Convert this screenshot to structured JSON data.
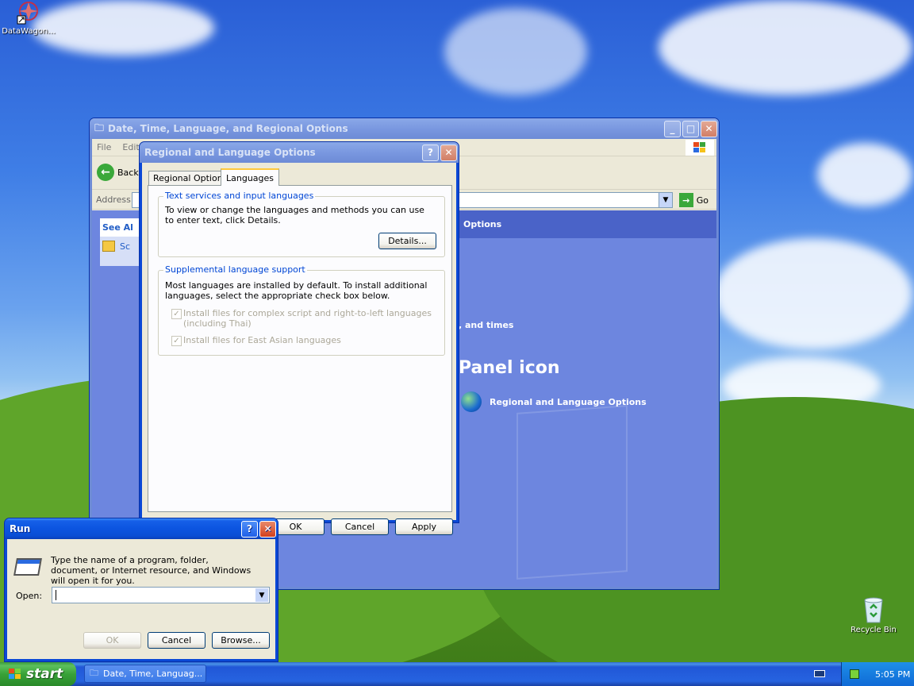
{
  "desktop": {
    "icons": [
      {
        "label": "DataWagon..."
      },
      {
        "label": "Recycle Bin"
      }
    ]
  },
  "control_panel_window": {
    "title": "Date, Time, Language, and Regional Options",
    "menu": [
      "File",
      "Edit"
    ],
    "back_label": "Back",
    "address_label": "Address",
    "go_label": "Go",
    "see_also": "See Al",
    "side_item": "Sc",
    "header_fragment": "Options",
    "task_fragment": ", and times",
    "pick_heading": "Panel icon",
    "cp_icon_label": "Regional and Language Options"
  },
  "regional_dialog": {
    "title": "Regional and Language Options",
    "help_glyph": "?",
    "close_glyph": "✕",
    "tabs": [
      "Regional Options",
      "Languages"
    ],
    "active_tab": "Languages",
    "text_services": {
      "legend": "Text services and input languages",
      "desc": "To view or change the languages and methods you can use to enter text, click Details.",
      "details_button": "Details..."
    },
    "supplemental": {
      "legend": "Supplemental language support",
      "desc": "Most languages are installed by default. To install additional languages, select the appropriate check box below.",
      "checkbox1": "Install files for complex script and right-to-left languages (including Thai)",
      "checkbox2": "Install files for East Asian languages"
    },
    "ok": "OK",
    "cancel": "Cancel",
    "apply": "Apply"
  },
  "run_dialog": {
    "title": "Run",
    "desc": "Type the name of a program, folder, document, or Internet resource, and Windows will open it for you.",
    "open_label": "Open:",
    "open_value": "",
    "ok": "OK",
    "cancel": "Cancel",
    "browse": "Browse..."
  },
  "taskbar": {
    "start_label": "start",
    "task_button": "Date, Time, Languag...",
    "clock": "5:05 PM"
  }
}
